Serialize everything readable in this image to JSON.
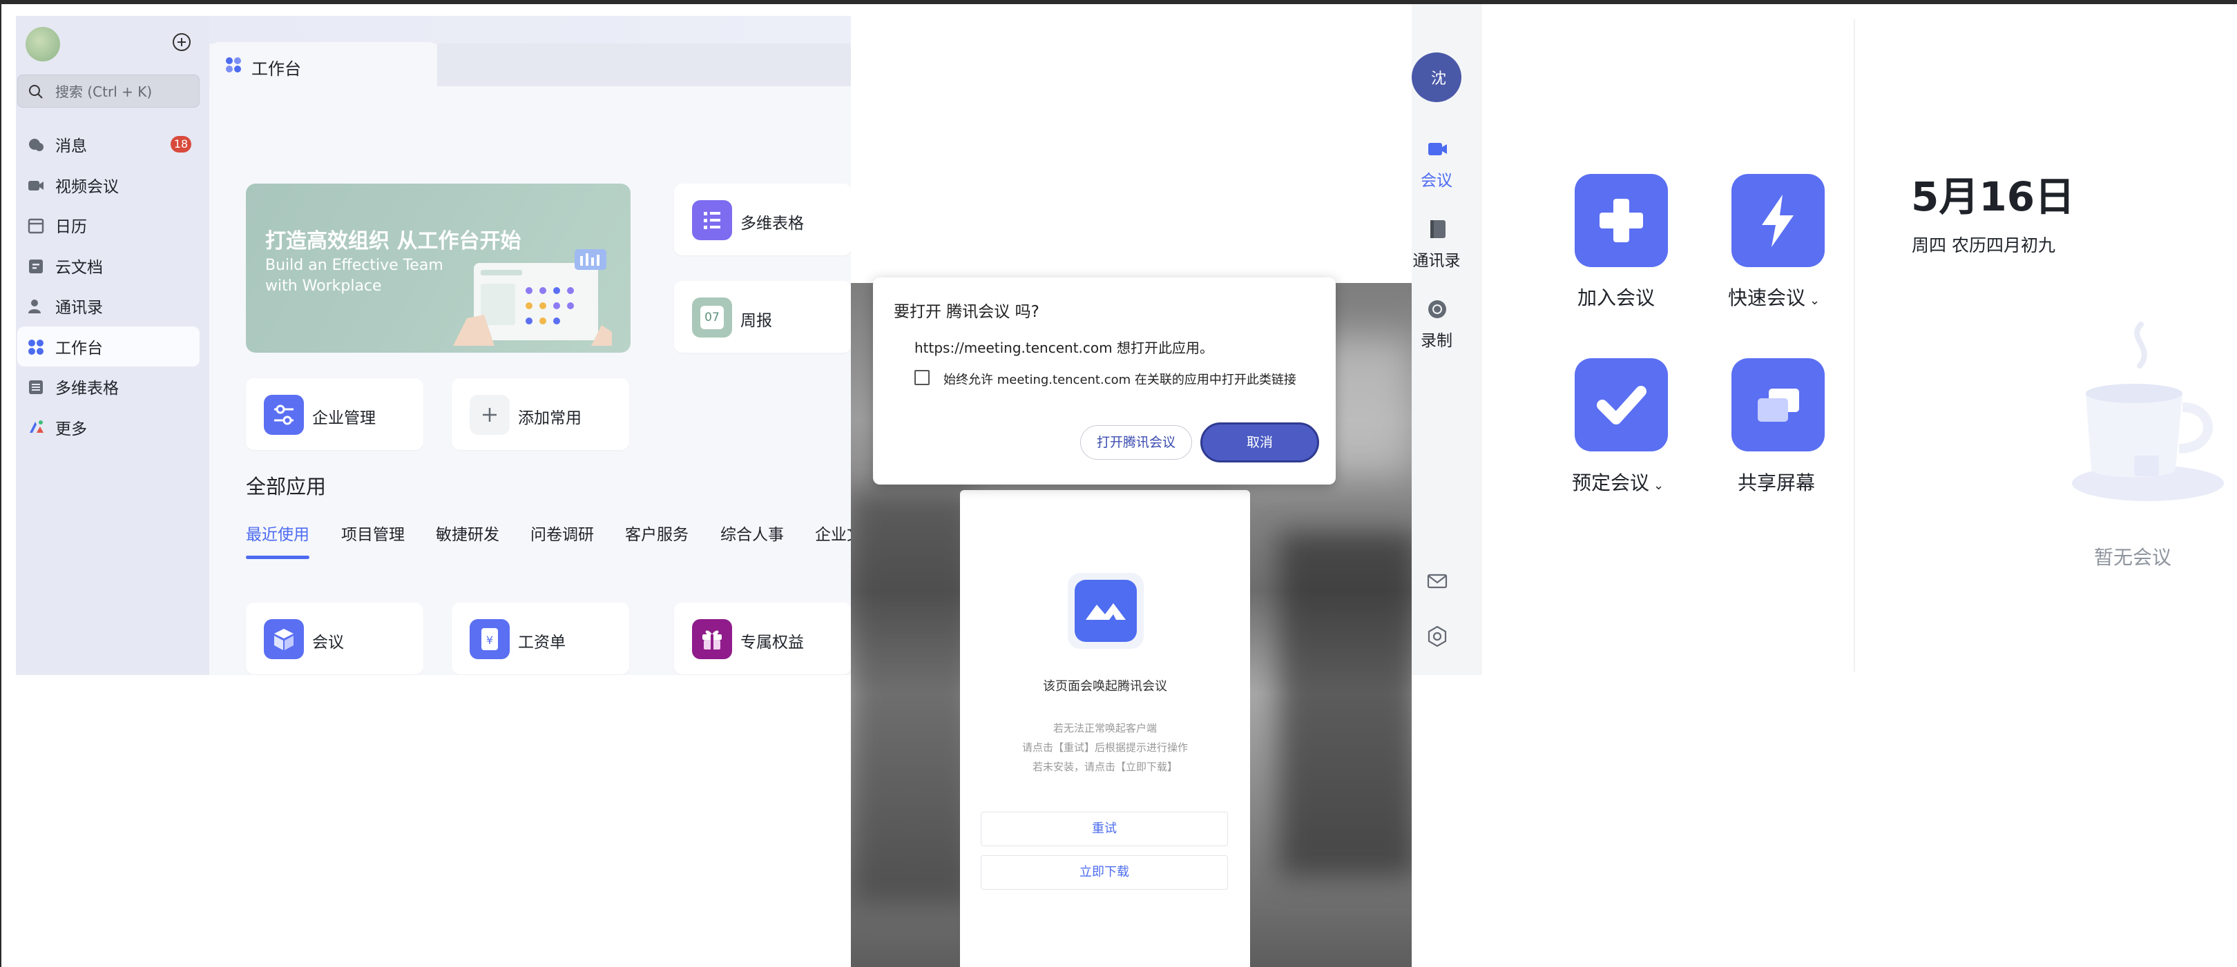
{
  "workbench": {
    "sidebar": {
      "search_placeholder": "搜索 (Ctrl + K)",
      "items": [
        {
          "label": "消息",
          "badge": "18"
        },
        {
          "label": "视频会议"
        },
        {
          "label": "日历"
        },
        {
          "label": "云文档"
        },
        {
          "label": "通讯录"
        },
        {
          "label": "工作台",
          "active": true
        },
        {
          "label": "多维表格"
        },
        {
          "label": "更多"
        }
      ]
    },
    "tab": {
      "label": "工作台"
    },
    "banner": {
      "title": "打造高效组织 从工作台开始",
      "subtitle_line1": "Build an Effective Team",
      "subtitle_line2": "with Workplace"
    },
    "quick_cards": {
      "bitable": "多维表格",
      "weekly": "周报",
      "weekly_icon_text": "07",
      "admin": "企业管理",
      "add_common": "添加常用"
    },
    "all_apps": {
      "title": "全部应用",
      "categories": [
        "最近使用",
        "项目管理",
        "敏捷研发",
        "问卷调研",
        "客户服务",
        "综合人事",
        "企业文"
      ],
      "apps": [
        {
          "label": "会议"
        },
        {
          "label": "工资单"
        },
        {
          "label": "专属权益"
        }
      ]
    }
  },
  "browser_page": {
    "title": "该页面会唤起腾讯会议",
    "hint_line1": "若无法正常唤起客户端",
    "hint_line2": "请点击【重试】后根据提示进行操作",
    "hint_line3": "若未安装，请点击【立即下载】",
    "retry": "重试",
    "download": "立即下载"
  },
  "dialog": {
    "title": "要打开 腾讯会议 吗?",
    "url_message": "https://meeting.tencent.com 想打开此应用。",
    "checkbox_label": "始终允许 meeting.tencent.com 在关联的应用中打开此类链接",
    "open_button": "打开腾讯会议",
    "cancel_button": "取消"
  },
  "meeting": {
    "avatar_text": "沈",
    "rail": {
      "meetings": "会议",
      "contacts": "通讯录",
      "recording": "录制"
    },
    "tiles": {
      "join": "加入会议",
      "quick": "快速会议",
      "schedule": "预定会议",
      "share": "共享屏幕"
    },
    "date": "5月16日",
    "date_sub": "周四 农历四月初九",
    "empty": "暂无会议"
  },
  "colors": {
    "accent": "#4c6bf0",
    "tile": "#5a6ff2",
    "badge": "#d84a3b",
    "dialog_primary": "#4d5cc4"
  }
}
